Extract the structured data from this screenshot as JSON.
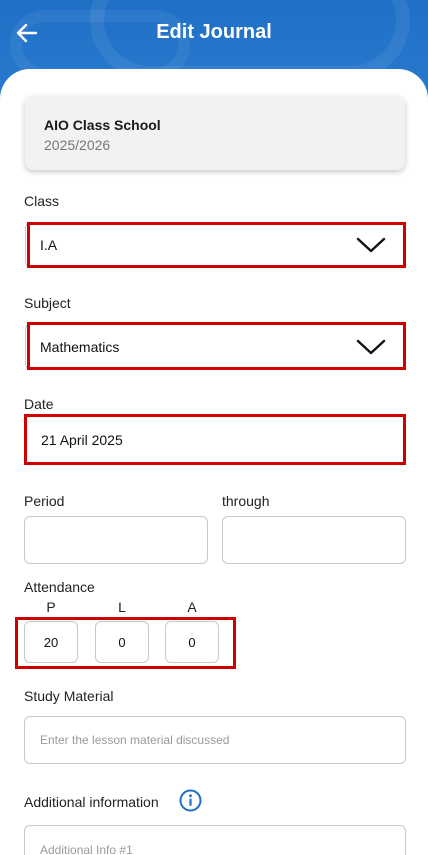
{
  "header": {
    "title": "Edit Journal",
    "back_icon": "arrow-left-icon"
  },
  "school": {
    "name": "AIO Class School",
    "year": "2025/2026"
  },
  "class_field": {
    "label": "Class",
    "value": "I.A"
  },
  "subject_field": {
    "label": "Subject",
    "value": "Mathematics"
  },
  "date_field": {
    "label": "Date",
    "value": "21 April 2025"
  },
  "period": {
    "label": "Period",
    "through_label": "through",
    "from_value": "",
    "to_value": ""
  },
  "attendance": {
    "label": "Attendance",
    "columns": [
      {
        "head": "P",
        "value": "20"
      },
      {
        "head": "L",
        "value": "0"
      },
      {
        "head": "A",
        "value": "0"
      }
    ]
  },
  "study_material": {
    "label": "Study Material",
    "placeholder": "Enter the lesson material discussed"
  },
  "additional_info": {
    "label": "Additional information",
    "placeholder": "Additional Info #1"
  },
  "colors": {
    "header_blue": "#1f6fc6",
    "highlight_red": "#d00000"
  }
}
